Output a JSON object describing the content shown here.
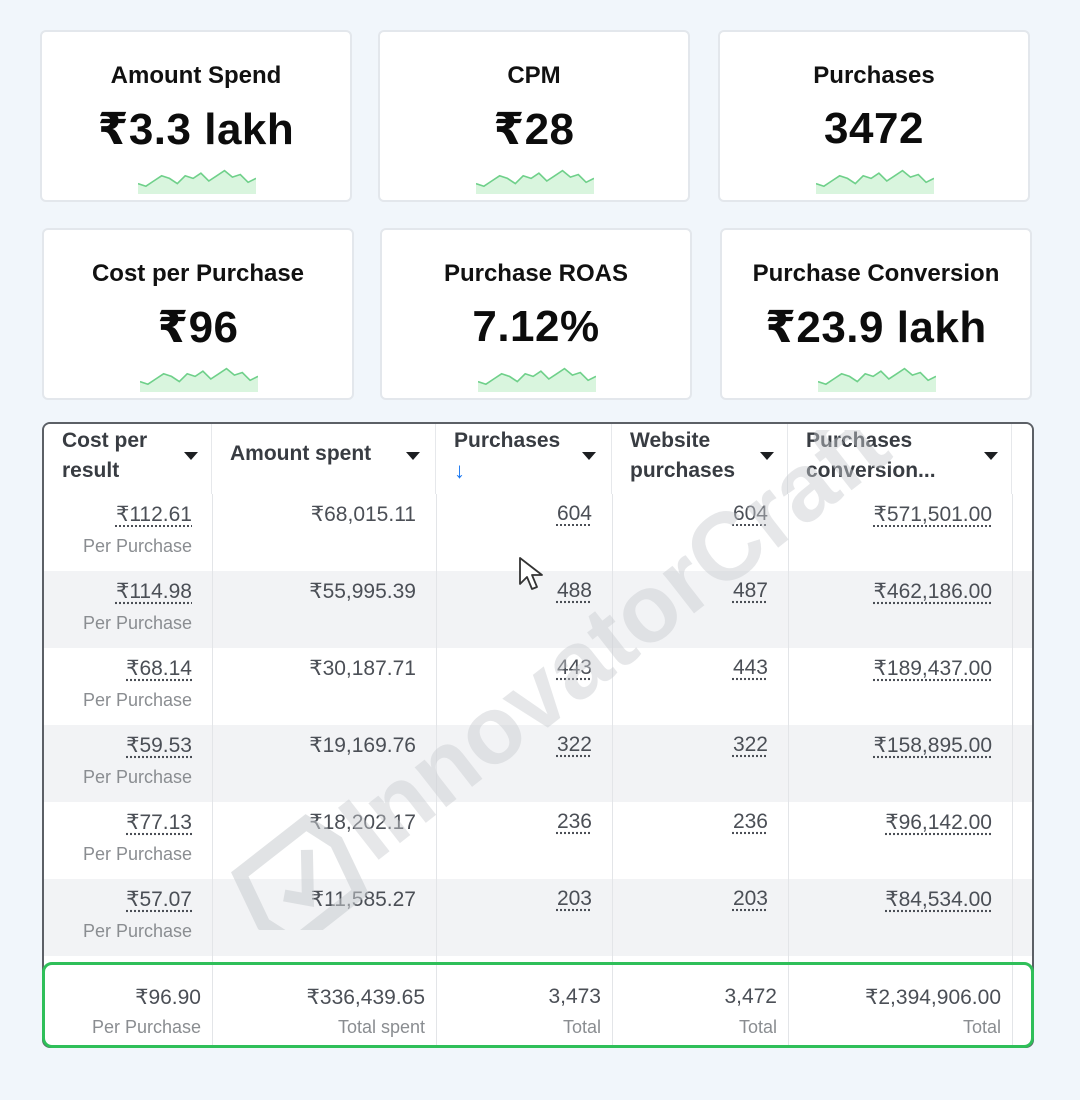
{
  "kpis": [
    {
      "title": "Amount Spend",
      "value": "₹3.3 lakh"
    },
    {
      "title": "CPM",
      "value": "₹28"
    },
    {
      "title": "Purchases",
      "value": "3472"
    },
    {
      "title": "Cost per Purchase",
      "value": "₹96"
    },
    {
      "title": "Purchase ROAS",
      "value": "7.12%"
    },
    {
      "title": "Purchase Conversion",
      "value": "₹23.9 lakh"
    }
  ],
  "sparkline": [
    8,
    6,
    10,
    14,
    12,
    8,
    14,
    12,
    16,
    10,
    14,
    18,
    13,
    15,
    9,
    12
  ],
  "colors": {
    "accent": "#1877f2",
    "highlight": "#2fbf59",
    "spark_fill": "#d9f5de",
    "spark_line": "#6fd08a"
  },
  "table": {
    "headers": [
      {
        "line1": "Cost per",
        "line2": "result"
      },
      {
        "line1": "Amount spent",
        "line2": ""
      },
      {
        "line1": "Purchases",
        "line2": "↓"
      },
      {
        "line1": "Website",
        "line2": "purchases"
      },
      {
        "line1": "Purchases",
        "line2": "conversion..."
      }
    ],
    "rows": [
      {
        "cpr": "₹112.61",
        "cpr_sub": "Per Purchase",
        "spent": "₹68,015.11",
        "purchases": "604",
        "web": "604",
        "conv": "₹571,501.00"
      },
      {
        "cpr": "₹114.98",
        "cpr_sub": "Per Purchase",
        "spent": "₹55,995.39",
        "purchases": "488",
        "web": "487",
        "conv": "₹462,186.00"
      },
      {
        "cpr": "₹68.14",
        "cpr_sub": "Per Purchase",
        "spent": "₹30,187.71",
        "purchases": "443",
        "web": "443",
        "conv": "₹189,437.00"
      },
      {
        "cpr": "₹59.53",
        "cpr_sub": "Per Purchase",
        "spent": "₹19,169.76",
        "purchases": "322",
        "web": "322",
        "conv": "₹158,895.00"
      },
      {
        "cpr": "₹77.13",
        "cpr_sub": "Per Purchase",
        "spent": "₹18,202.17",
        "purchases": "236",
        "web": "236",
        "conv": "₹96,142.00"
      },
      {
        "cpr": "₹57.07",
        "cpr_sub": "Per Purchase",
        "spent": "₹11,585.27",
        "purchases": "203",
        "web": "203",
        "conv": "₹84,534.00"
      }
    ],
    "totals": {
      "cpr": "₹96.90",
      "cpr_sub": "Per Purchase",
      "spent": "₹336,439.65",
      "spent_sub": "Total spent",
      "purchases": "3,473",
      "purchases_sub": "Total",
      "web": "3,472",
      "web_sub": "Total",
      "conv": "₹2,394,906.00",
      "conv_sub": "Total"
    }
  },
  "watermark_text": "InnovatorCraft",
  "watermark_logo_icon": "check-shield-icon",
  "cursor_icon": "mouse-pointer-icon"
}
